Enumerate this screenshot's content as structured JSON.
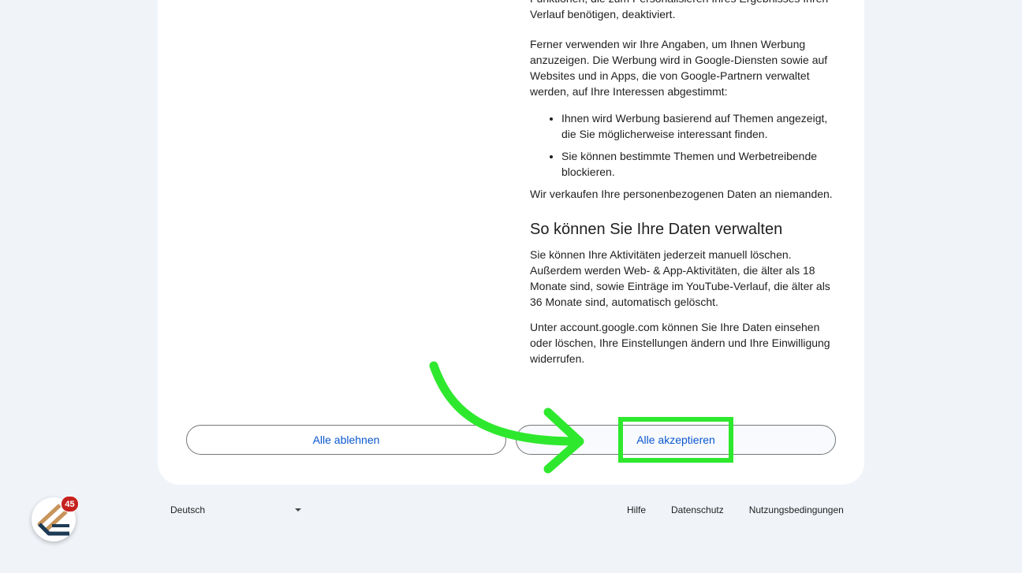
{
  "content": {
    "paragraph_intro": "Funktionen, die zum Personalisieren Ihres Ergebnisses Ihren Verlauf benötigen, deaktiviert.",
    "paragraph_ads": "Ferner verwenden wir Ihre Angaben, um Ihnen Werbung anzuzeigen. Die Werbung wird in Google-Diensten sowie auf Websites und in Apps, die von Google-Partnern verwaltet werden, auf Ihre Interessen abgestimmt:",
    "bullets": [
      "Ihnen wird Werbung basierend auf Themen angezeigt, die Sie möglicherweise interessant finden.",
      "Sie können bestimmte Themen und Werbetreibende blockieren."
    ],
    "paragraph_sell": "Wir verkaufen Ihre personenbezogenen Daten an niemanden.",
    "heading_manage": "So können Sie Ihre Daten verwalten",
    "paragraph_delete": "Sie können Ihre Aktivitäten jederzeit manuell löschen. Außerdem werden Web- & App-Aktivitäten, die älter als 18 Monate sind, sowie Einträge im YouTube-Verlauf, die älter als 36 Monate sind, automatisch gelöscht.",
    "paragraph_account": "Unter account.google.com können Sie Ihre Daten einsehen oder löschen, Ihre Einstellungen ändern und Ihre Einwilligung widerrufen."
  },
  "buttons": {
    "reject_all": "Alle ablehnen",
    "accept_all": "Alle akzeptieren"
  },
  "footer": {
    "language": "Deutsch",
    "links": [
      "Hilfe",
      "Datenschutz",
      "Nutzungsbedingungen"
    ]
  },
  "widget": {
    "badge_count": "45",
    "icon": "extension-logo-icon"
  },
  "annotation": {
    "arrow_color": "#2ee82e",
    "box_color": "#2ee82e"
  },
  "colors": {
    "background": "#f0f4f9",
    "button_text": "#0b57d0",
    "badge": "#c5221f"
  }
}
